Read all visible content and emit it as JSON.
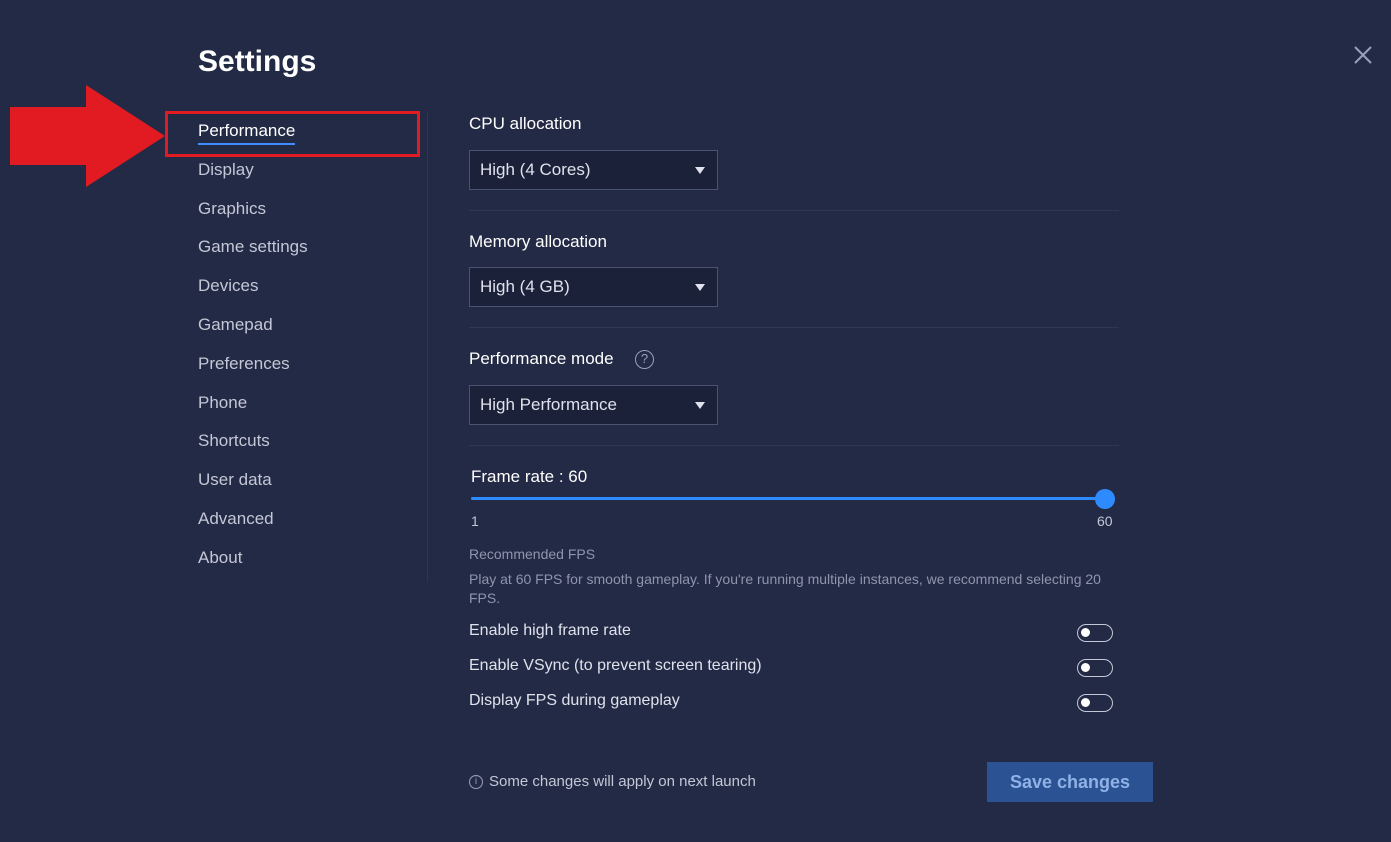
{
  "page": {
    "title": "Settings"
  },
  "sidebar": {
    "items": [
      {
        "label": "Performance",
        "active": true
      },
      {
        "label": "Display"
      },
      {
        "label": "Graphics"
      },
      {
        "label": "Game settings"
      },
      {
        "label": "Devices"
      },
      {
        "label": "Gamepad"
      },
      {
        "label": "Preferences"
      },
      {
        "label": "Phone"
      },
      {
        "label": "Shortcuts"
      },
      {
        "label": "User data"
      },
      {
        "label": "Advanced"
      },
      {
        "label": "About"
      }
    ]
  },
  "performance": {
    "cpu": {
      "label": "CPU allocation",
      "value": "High (4 Cores)"
    },
    "memory": {
      "label": "Memory allocation",
      "value": "High (4 GB)"
    },
    "mode": {
      "label": "Performance mode",
      "value": "High Performance",
      "help": "?"
    },
    "frame_rate": {
      "label": "Frame rate : 60",
      "min": "1",
      "max": "60",
      "value": 60
    },
    "recommended": {
      "title": "Recommended FPS",
      "body": "Play at 60 FPS for smooth gameplay. If you're running multiple instances, we recommend selecting 20 FPS."
    },
    "toggles": [
      {
        "label": "Enable high frame rate",
        "on": false
      },
      {
        "label": "Enable VSync (to prevent screen tearing)",
        "on": false
      },
      {
        "label": "Display FPS during gameplay",
        "on": false
      }
    ]
  },
  "footer": {
    "info_icon": "i",
    "note": "Some changes will apply on next launch",
    "save_label": "Save changes"
  },
  "colors": {
    "background": "#232a45",
    "accent": "#2e8bff",
    "annotation_red": "#e21b22",
    "save_button": "#2b5394"
  },
  "icons": {
    "close": "close-icon",
    "dropdown": "caret-down-icon",
    "help": "help-icon",
    "info": "info-icon"
  }
}
